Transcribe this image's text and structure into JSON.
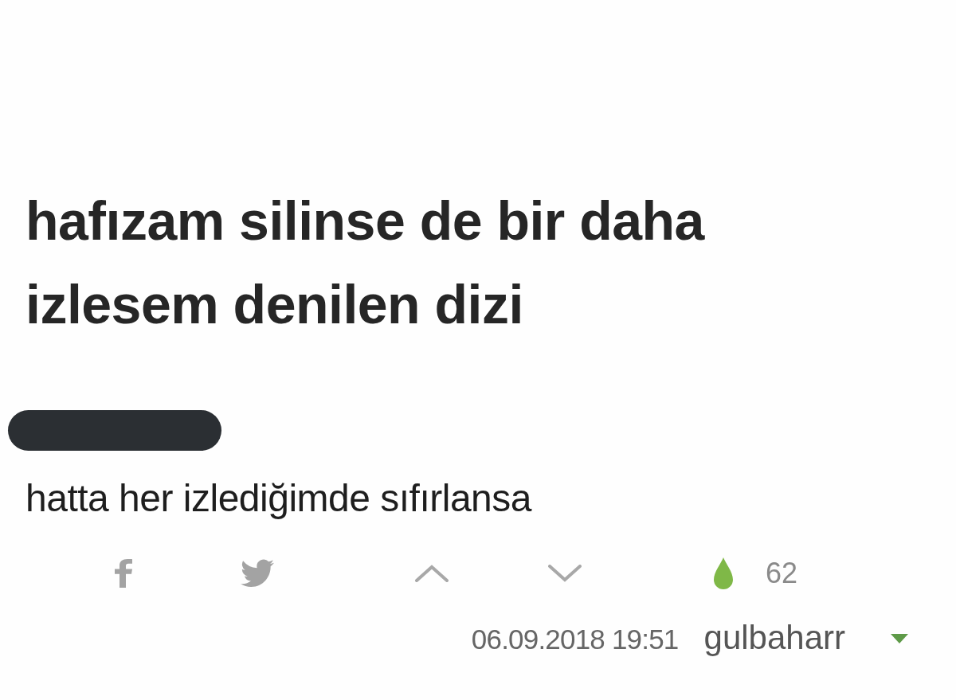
{
  "entry": {
    "title": "hafızam silinse de bir daha izlesem denilen dizi",
    "redacted": true,
    "body": "hatta her izlediğimde sıfırlansa"
  },
  "actions": {
    "favorite_count": "62"
  },
  "footer": {
    "date": "06.09.2018 19:51",
    "author": "gulbaharr"
  }
}
